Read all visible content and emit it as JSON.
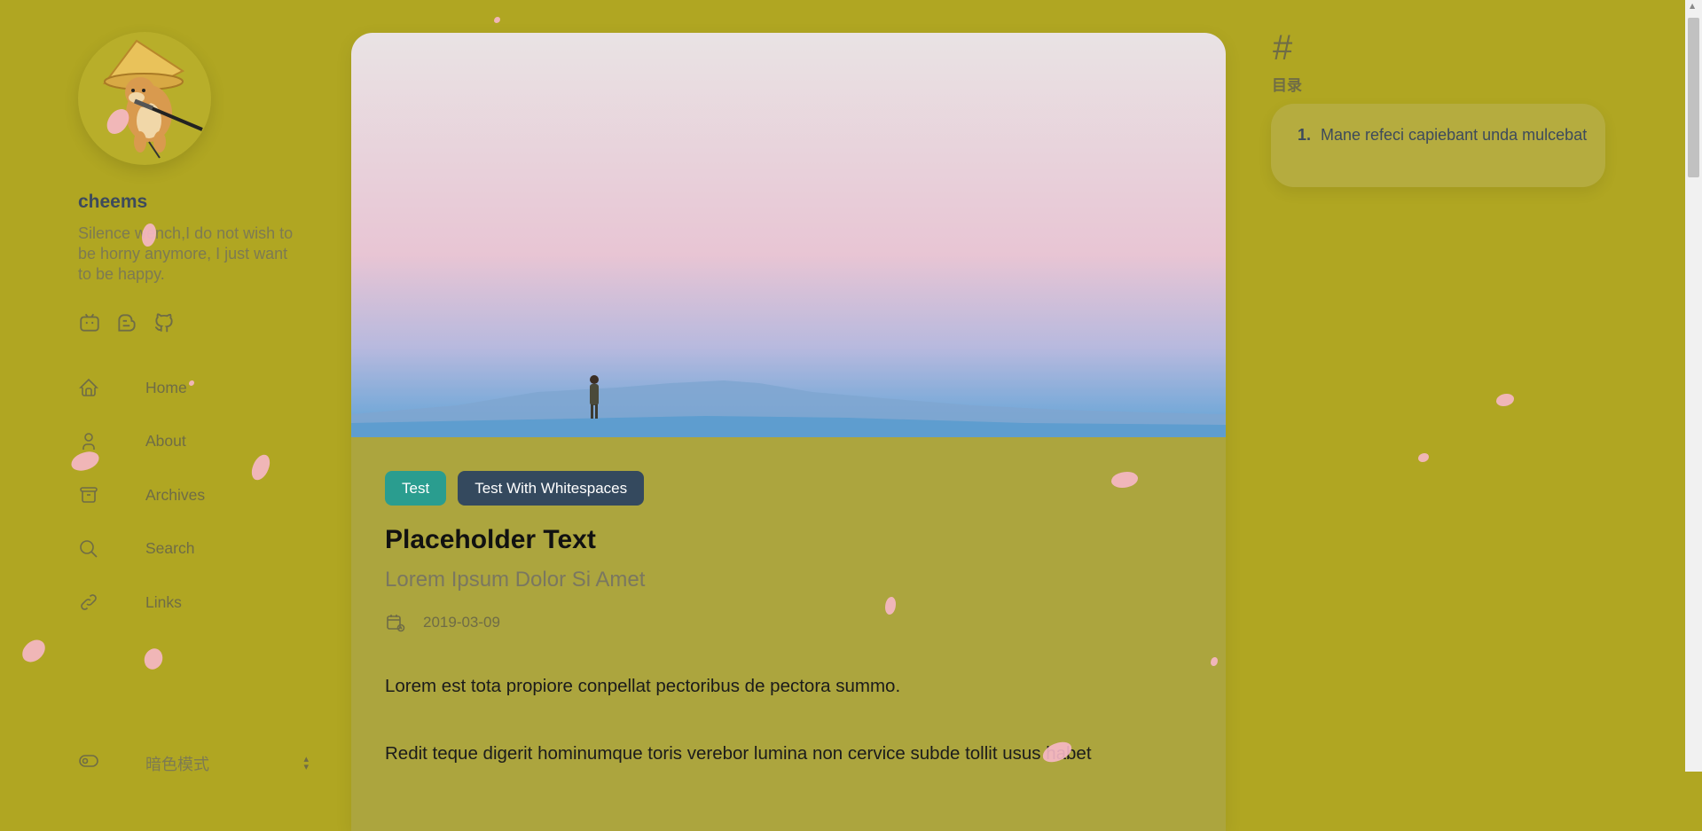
{
  "sidebar": {
    "site_name": "cheems",
    "description": "Silence wench,I do not wish to be horny anymore, I just want to be happy.",
    "social_icons": [
      "bilibili-icon",
      "blog-icon",
      "github-icon"
    ],
    "menu": [
      {
        "label": "Home",
        "icon": "home-icon"
      },
      {
        "label": "About",
        "icon": "user-icon"
      },
      {
        "label": "Archives",
        "icon": "archive-icon"
      },
      {
        "label": "Search",
        "icon": "search-icon"
      },
      {
        "label": "Links",
        "icon": "link-icon"
      }
    ],
    "dark_mode_label": "暗色模式"
  },
  "article": {
    "tags": [
      "Test",
      "Test With Whitespaces"
    ],
    "title": "Placeholder Text",
    "subtitle": "Lorem Ipsum Dolor Si Amet",
    "date": "2019-03-09",
    "paragraphs": [
      "Lorem est tota propiore conpellat pectoribus de pectora summo.",
      "Redit teque digerit hominumque toris verebor lumina non cervice subde tollit usus habet"
    ]
  },
  "toc": {
    "hash": "#",
    "title": "目录",
    "items": [
      {
        "number": "1.",
        "text": "Mane refeci capiebant unda mulcebat"
      }
    ]
  },
  "colors": {
    "background": "#b0a622",
    "card": "#aca53e",
    "tag_primary": "#2a9d8f",
    "tag_secondary": "#34495e",
    "petal": "#f7b8c8"
  }
}
